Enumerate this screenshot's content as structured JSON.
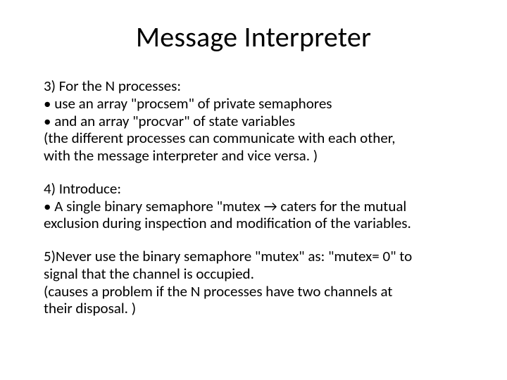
{
  "title": "Message Interpreter",
  "section3": {
    "heading": "3) For the N processes:",
    "b1": "use an array \"procsem\" of private semaphores",
    "b2": "and an array \"procvar\" of state variables",
    "tail1": "(the different processes can communicate with each other,",
    "tail2": "with the message interpreter and vice versa. )"
  },
  "section4": {
    "heading": "4) Introduce:",
    "b1a": "A single binary semaphore \"mutex → caters for the mutual",
    "b1b": "exclusion during inspection and modification of the variables."
  },
  "section5": {
    "l1": "5)Never use the binary semaphore \"mutex\" as: \"mutex= 0\" to",
    "l2": "signal that the channel is occupied.",
    "l3": "(causes a problem if the N processes have two channels at",
    "l4": "their disposal. )"
  }
}
